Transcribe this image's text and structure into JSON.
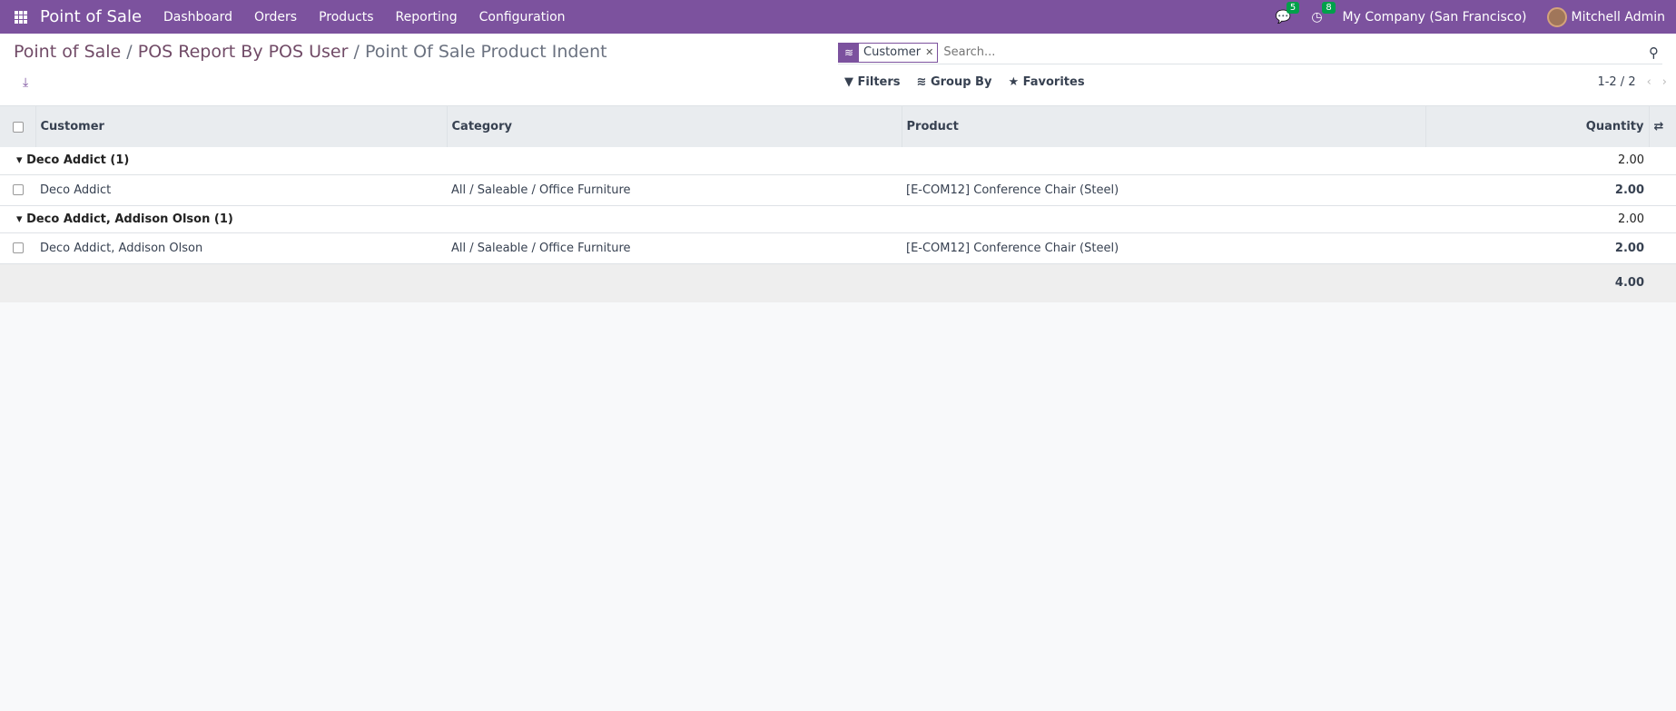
{
  "navbar": {
    "app": "Point of Sale",
    "menus": [
      "Dashboard",
      "Orders",
      "Products",
      "Reporting",
      "Configuration"
    ],
    "messages_count": "5",
    "activities_count": "8",
    "company": "My Company (San Francisco)",
    "user": "Mitchell Admin"
  },
  "breadcrumb": {
    "items": [
      "Point of Sale",
      "POS Report By POS User"
    ],
    "current": "Point Of Sale Product Indent"
  },
  "search": {
    "facet": "Customer",
    "placeholder": "Search..."
  },
  "toolbar": {
    "filters": "Filters",
    "group_by": "Group By",
    "favorites": "Favorites",
    "pager": "1-2 / 2"
  },
  "table": {
    "headers": [
      "Customer",
      "Category",
      "Product",
      "Quantity"
    ],
    "groups": [
      {
        "label": "Deco Addict (1)",
        "total": "2.00",
        "rows": [
          {
            "customer": "Deco Addict",
            "category": "All / Saleable / Office Furniture",
            "product": "[E-COM12] Conference Chair (Steel)",
            "quantity": "2.00"
          }
        ]
      },
      {
        "label": "Deco Addict, Addison Olson (1)",
        "total": "2.00",
        "rows": [
          {
            "customer": "Deco Addict, Addison Olson",
            "category": "All / Saleable / Office Furniture",
            "product": "[E-COM12] Conference Chair (Steel)",
            "quantity": "2.00"
          }
        ]
      }
    ],
    "grand_total": "4.00"
  }
}
